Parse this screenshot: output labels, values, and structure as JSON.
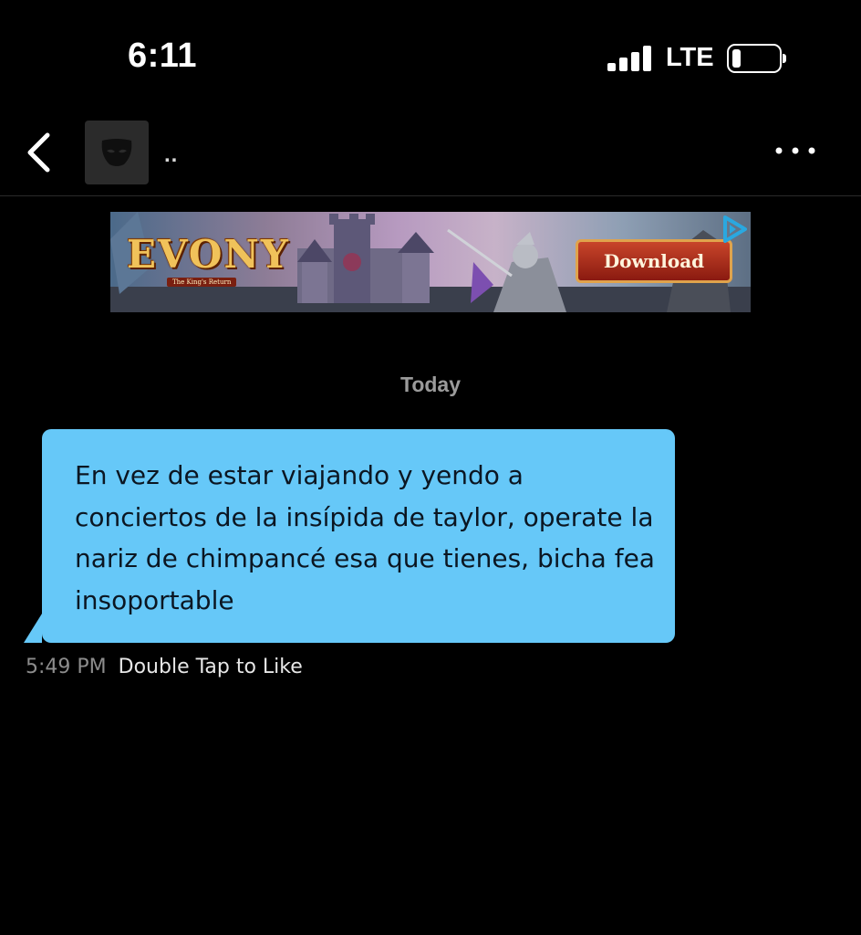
{
  "status_bar": {
    "time": "6:11",
    "network": "LTE",
    "signal_level": 4,
    "battery_level": 0.15
  },
  "header": {
    "back_icon": "chevron-left-icon",
    "avatar_icon": "mask-icon",
    "contact_name": "..",
    "more_icon": "ellipsis-icon"
  },
  "ad": {
    "brand": "EVONY",
    "tagline": "The King's Return",
    "cta": "Download",
    "choice_icon": "adchoices-icon"
  },
  "chat": {
    "date_separator": "Today",
    "messages": [
      {
        "text": "En vez de estar viajando y yendo a conciertos de la insípida de taylor, operate la nariz de chimpancé esa que tienes, bicha fea insoportable",
        "time": "5:49 PM",
        "hint": "Double Tap to Like"
      }
    ]
  },
  "colors": {
    "background": "#000000",
    "bubble": "#66c8f8",
    "meta_time": "#8c8c8c",
    "date_separator": "#9b9b9b"
  }
}
